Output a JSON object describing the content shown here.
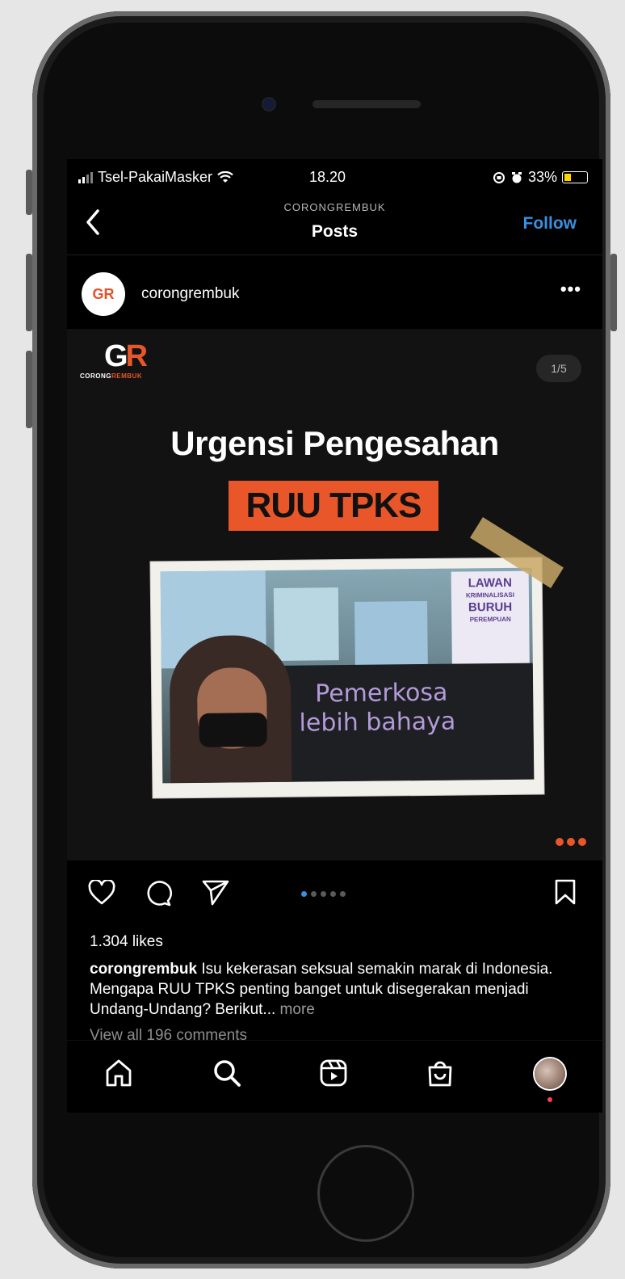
{
  "status_bar": {
    "carrier": "Tsel-PakaiMasker",
    "time": "18.20",
    "battery": "33%"
  },
  "nav": {
    "account": "CORONGREMBUK",
    "title": "Posts",
    "follow": "Follow",
    "back_icon": "chevron-left-icon"
  },
  "post_header": {
    "username": "corongrembuk",
    "avatar_text": "GR"
  },
  "post": {
    "logo_letters_g": "G",
    "logo_letters_r": "R",
    "logo_word_a": "CORONG",
    "logo_word_b": "REMBUK",
    "counter": "1/5",
    "headline": "Urgensi Pengesahan",
    "highlight": "RUU TPKS",
    "sign_lawan": "LAWAN",
    "sign_kriminalisasi": "KRIMINALISASI",
    "sign_buruh": "BURUH",
    "sign_perempuan": "PEREMPUAN",
    "banner_line1": "Pemerkosa",
    "banner_line2": "lebih bahaya"
  },
  "actions": {
    "icons": [
      "heart-icon",
      "comment-icon",
      "send-icon",
      "bookmark-icon"
    ],
    "page_count": 5,
    "active_page": 1
  },
  "likes": "1.304 likes",
  "caption": {
    "username": "corongrembuk",
    "text": "Isu kekerasan seksual semakin marak di Indonesia. Mengapa RUU TPKS penting banget untuk disegerakan menjadi Undang-Undang? Berikut...",
    "more": "more"
  },
  "comments_link": "View all 196 comments",
  "tab_bar": {
    "icons": [
      "home-icon",
      "search-icon",
      "reels-icon",
      "shop-icon",
      "profile-avatar"
    ]
  }
}
